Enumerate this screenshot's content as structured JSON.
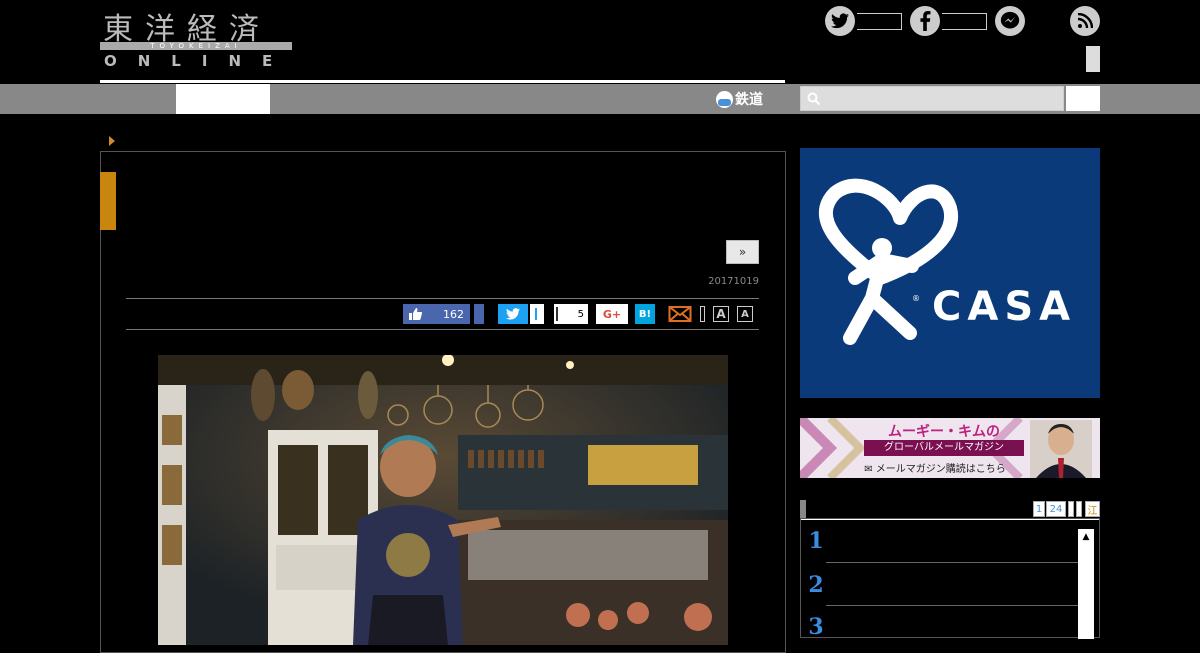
{
  "header": {
    "logo_kanji": "東洋経済",
    "logo_roman": "TOYOKEIZAI",
    "logo_online": "ONLINE",
    "social": [
      "twitter-icon",
      "facebook-icon",
      "messenger-icon",
      "rss-icon"
    ]
  },
  "nav": {
    "rail_label": "鉄道"
  },
  "article": {
    "next_label": "»",
    "date": "20171019",
    "share": {
      "like_count": "162",
      "pocket_count": "5",
      "gplus_label": "G+",
      "hatena_label": "B!",
      "font_large": "A",
      "font_small": "A"
    }
  },
  "sidebar": {
    "ad_brand": "CASA",
    "banner": {
      "title": "ムーギー・キムの",
      "subtitle": "グローバルメールマガジン",
      "cta": "メールマガジン購読はこちら"
    },
    "ranking": {
      "tabs": [
        "1",
        "24"
      ],
      "last_tab": "江",
      "numbers": [
        "1",
        "2",
        "3"
      ]
    }
  },
  "colors": {
    "accent": "#c9860e",
    "nav_gray": "#888888",
    "casa_blue": "#0a3a7a",
    "rank_blue": "#3a8ee0"
  }
}
